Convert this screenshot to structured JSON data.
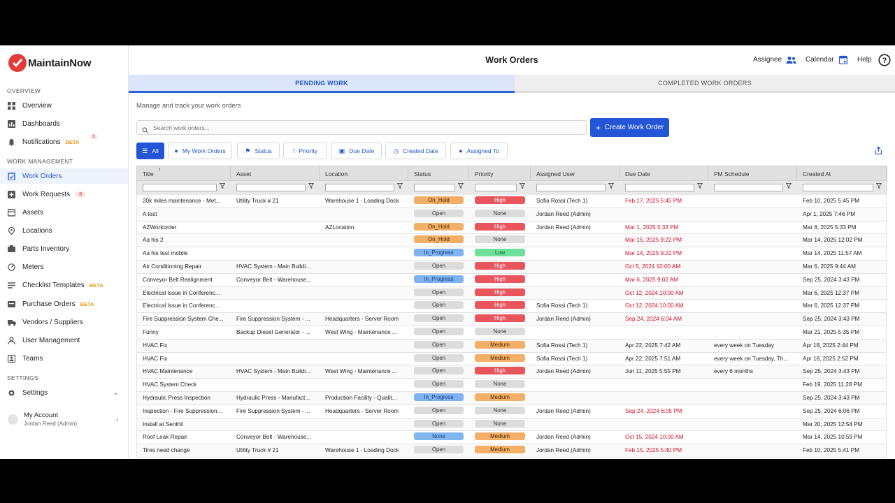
{
  "app": {
    "name": "MaintainNow"
  },
  "sidebar": {
    "sections": {
      "overview": "OVERVIEW",
      "work_management": "WORK MANAGEMENT",
      "settings": "SETTINGS"
    },
    "items": [
      {
        "label": "Overview",
        "icon": "grid-icon"
      },
      {
        "label": "Dashboards",
        "icon": "bar-chart-icon"
      },
      {
        "label": "Notifications",
        "icon": "bell-icon",
        "badge": "BETA",
        "count": "3"
      },
      {
        "label": "Work Orders",
        "icon": "clipboard-icon",
        "active": true
      },
      {
        "label": "Work Requests",
        "icon": "plus-box-icon",
        "count": "8"
      },
      {
        "label": "Assets",
        "icon": "box-icon"
      },
      {
        "label": "Locations",
        "icon": "pin-icon"
      },
      {
        "label": "Parts Inventory",
        "icon": "parts-icon"
      },
      {
        "label": "Meters",
        "icon": "gauge-icon"
      },
      {
        "label": "Checklist Templates",
        "icon": "checklist-icon",
        "badge": "BETA"
      },
      {
        "label": "Purchase Orders",
        "icon": "cart-icon",
        "badge": "BETA"
      },
      {
        "label": "Vendors / Suppliers",
        "icon": "truck-icon"
      },
      {
        "label": "User Management",
        "icon": "user-icon"
      },
      {
        "label": "Teams",
        "icon": "team-icon"
      },
      {
        "label": "Settings",
        "icon": "gear-icon"
      }
    ],
    "account": {
      "label": "My Account",
      "user": "Jordan Reed (Admin)"
    }
  },
  "header": {
    "title": "Work Orders",
    "assignee": "Assignee",
    "calendar": "Calendar",
    "help": "Help"
  },
  "tabs": {
    "pending": "PENDING WORK",
    "completed": "COMPLETED WORK ORDERS"
  },
  "subtitle": "Manage and track your work orders",
  "search": {
    "placeholder": "Search work orders..."
  },
  "create_button": "Create Work Order",
  "filters": [
    "All",
    "My Work Orders",
    "Status",
    "Priority",
    "Due Date",
    "Created Date",
    "Assigned To"
  ],
  "columns": [
    "Title",
    "Asset",
    "Location",
    "Status",
    "Priority",
    "Assigned User",
    "Due Date",
    "PM Schedule",
    "Created At"
  ],
  "rows": [
    {
      "title": "20k miles maintenance - Met...",
      "asset": "Utility Truck # 21",
      "location": "Warehouse 1 - Loading Dock",
      "status": "On_Hold",
      "priority": "High",
      "user": "Sofia Rossi (Tech 1)",
      "due": "Feb 17, 2025 5:45 PM",
      "due_red": true,
      "pm": "",
      "created": "Feb 10, 2025 5:45 PM"
    },
    {
      "title": "A test",
      "asset": "",
      "location": "",
      "status": "Open",
      "priority": "None",
      "user": "Jordan Reed (Admin)",
      "due": "",
      "due_red": false,
      "pm": "",
      "created": "Apr 1, 2025 7:46 PM"
    },
    {
      "title": "AZWorkorder",
      "asset": "",
      "location": "AZLocation",
      "status": "On_Hold",
      "priority": "High",
      "user": "Jordan Reed (Admin)",
      "due": "Mar 1, 2025 5:33 PM",
      "due_red": true,
      "pm": "",
      "created": "Mar 8, 2025 5:33 PM"
    },
    {
      "title": "Aa his 2",
      "asset": "",
      "location": "",
      "status": "On_Hold",
      "priority": "None",
      "user": "",
      "due": "Mar 15, 2025 9:22 PM",
      "due_red": true,
      "pm": "",
      "created": "Mar 14, 2025 12:02 PM"
    },
    {
      "title": "Aa his test mobile",
      "asset": "",
      "location": "",
      "status": "In_Progress",
      "priority": "Low",
      "user": "",
      "due": "Mar 14, 2025 9:22 PM",
      "due_red": true,
      "pm": "",
      "created": "Mar 14, 2025 11:57 AM"
    },
    {
      "title": "Air Conditioning Repair",
      "asset": "HVAC System - Main Buildi...",
      "location": "",
      "status": "Open",
      "priority": "High",
      "user": "",
      "due": "Oct 5, 2024 10:00 AM",
      "due_red": true,
      "pm": "",
      "created": "Mar 6, 2025 9:44 AM"
    },
    {
      "title": "Conveyor Belt Realignment",
      "asset": "Conveyor Belt - Warehouse...",
      "location": "",
      "status": "In_Progress",
      "priority": "High",
      "user": "",
      "due": "Mar 6, 2025 9:02 AM",
      "due_red": true,
      "pm": "",
      "created": "Sep 25, 2024 3:43 PM"
    },
    {
      "title": "Electrical Issue in Conferenc...",
      "asset": "",
      "location": "",
      "status": "Open",
      "priority": "High",
      "user": "",
      "due": "Oct 12, 2024 10:00 AM",
      "due_red": true,
      "pm": "",
      "created": "Mar 6, 2025 12:37 PM"
    },
    {
      "title": "Electrical Issue in Conferenc...",
      "asset": "",
      "location": "",
      "status": "Open",
      "priority": "High",
      "user": "Sofia Rossi (Tech 1)",
      "due": "Oct 12, 2024 10:00 AM",
      "due_red": true,
      "pm": "",
      "created": "Mar 6, 2025 12:37 PM"
    },
    {
      "title": "Fire Suppression System Che...",
      "asset": "Fire Suppression System - ...",
      "location": "Headquarters - Server Room",
      "status": "Open",
      "priority": "High",
      "user": "Jordan Reed (Admin)",
      "due": "Sep 24, 2024 6:04 AM",
      "due_red": true,
      "pm": "",
      "created": "Sep 25, 2024 3:43 PM"
    },
    {
      "title": "Funny",
      "asset": "Backup Diesel Generator - ...",
      "location": "West Wing - Maintenance ...",
      "status": "Open",
      "priority": "None",
      "user": "",
      "due": "",
      "due_red": false,
      "pm": "",
      "created": "Mar 21, 2025 5:35 PM"
    },
    {
      "title": "HVAC Fix",
      "asset": "",
      "location": "",
      "status": "Open",
      "priority": "Medium",
      "user": "Sofia Rossi (Tech 1)",
      "due": "Apr 22, 2025 7:42 AM",
      "due_red": false,
      "pm": "every week on Tuesday",
      "created": "Apr 18, 2025 2:44 PM"
    },
    {
      "title": "HVAC Fix",
      "asset": "",
      "location": "",
      "status": "Open",
      "priority": "Medium",
      "user": "Sofia Rossi (Tech 1)",
      "due": "Apr 22, 2025 7:51 AM",
      "due_red": false,
      "pm": "every week on Tuesday, Th...",
      "created": "Apr 18, 2025 2:52 PM"
    },
    {
      "title": "HVAC Maintenance",
      "asset": "HVAC System - Main Buildi...",
      "location": "West Wing - Maintenance ...",
      "status": "Open",
      "priority": "High",
      "user": "Jordan Reed (Admin)",
      "due": "Jun 11, 2025 5:55 PM",
      "due_red": false,
      "pm": "every 6 months",
      "created": "Sep 25, 2024 3:43 PM"
    },
    {
      "title": "HVAC System Check",
      "asset": "",
      "location": "",
      "status": "Open",
      "priority": "None",
      "user": "",
      "due": "",
      "due_red": false,
      "pm": "",
      "created": "Feb 19, 2025 11:28 PM"
    },
    {
      "title": "Hydraulic Press Inspection",
      "asset": "Hydraulic Press - Manufact...",
      "location": "Production Facility - Qualit...",
      "status": "In_Progress",
      "priority": "Medium",
      "user": "",
      "due": "",
      "due_red": false,
      "pm": "",
      "created": "Sep 25, 2024 3:43 PM"
    },
    {
      "title": "Inspection - Fire Suppression...",
      "asset": "Fire Suppression System - ...",
      "location": "Headquarters - Server Room",
      "status": "Open",
      "priority": "None",
      "user": "Jordan Reed (Admin)",
      "due": "Sep 24, 2024 6:05 PM",
      "due_red": true,
      "pm": "",
      "created": "Sep 25, 2024 6:06 PM"
    },
    {
      "title": "Install at Senthil",
      "asset": "",
      "location": "",
      "status": "Open",
      "priority": "None",
      "user": "",
      "due": "",
      "due_red": false,
      "pm": "",
      "created": "Mar 20, 2025 12:54 PM"
    },
    {
      "title": "Roof Leak Repair",
      "asset": "Conveyor Belt - Warehouse...",
      "location": "",
      "status": "None",
      "priority": "Medium",
      "user": "Jordan Reed (Admin)",
      "due": "Oct 15, 2024 10:00 AM",
      "due_red": true,
      "pm": "",
      "created": "Mar 14, 2025 10:59 PM"
    },
    {
      "title": "Tires need change",
      "asset": "Utility Truck # 21",
      "location": "Warehouse 1 - Loading Dock",
      "status": "Open",
      "priority": "Medium",
      "user": "Jordan Reed (Admin)",
      "due": "Feb 15, 2025 5:40 PM",
      "due_red": true,
      "pm": "",
      "created": "Feb 10, 2025 5:41 PM"
    }
  ],
  "colors": {
    "accent": "#2455d6",
    "high": "#e8555d",
    "hold": "#f3ae67",
    "progress": "#7fb2f2",
    "low": "#6fe09a",
    "due_red": "#d0102a"
  }
}
